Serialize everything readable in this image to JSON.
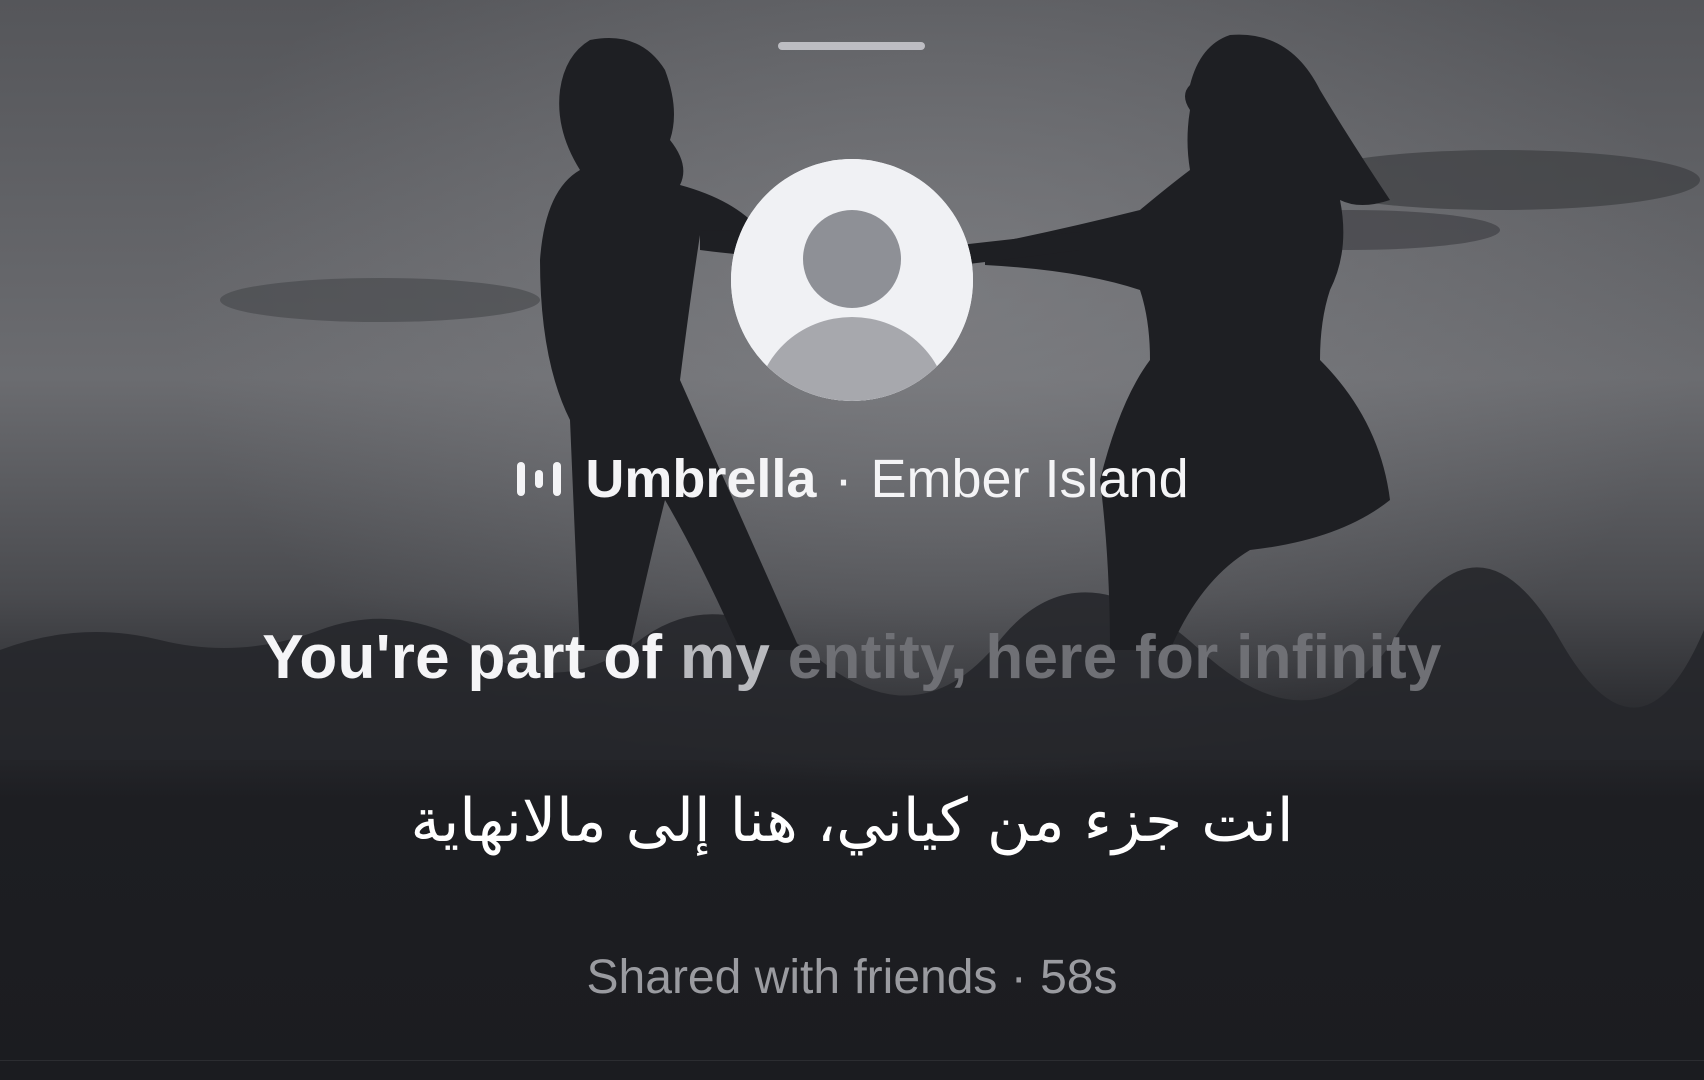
{
  "track": {
    "title": "Umbrella",
    "separator": "·",
    "artist": "Ember Island",
    "icon": "audio-waveform-icon"
  },
  "avatar": {
    "icon": "default-profile-icon"
  },
  "lyric": {
    "sung": "You're part of",
    "current": "my",
    "upcoming": "entity, here for infinity"
  },
  "translation": {
    "text": "انت جزء من كياني، هنا إلى مالانهاية"
  },
  "footer": {
    "text": "Shared with friends · 58s"
  },
  "colors": {
    "background": "#1b1c20",
    "text_primary": "#f5f5f7",
    "text_dim": "#6f7075",
    "text_footer": "#9a9ba0"
  }
}
